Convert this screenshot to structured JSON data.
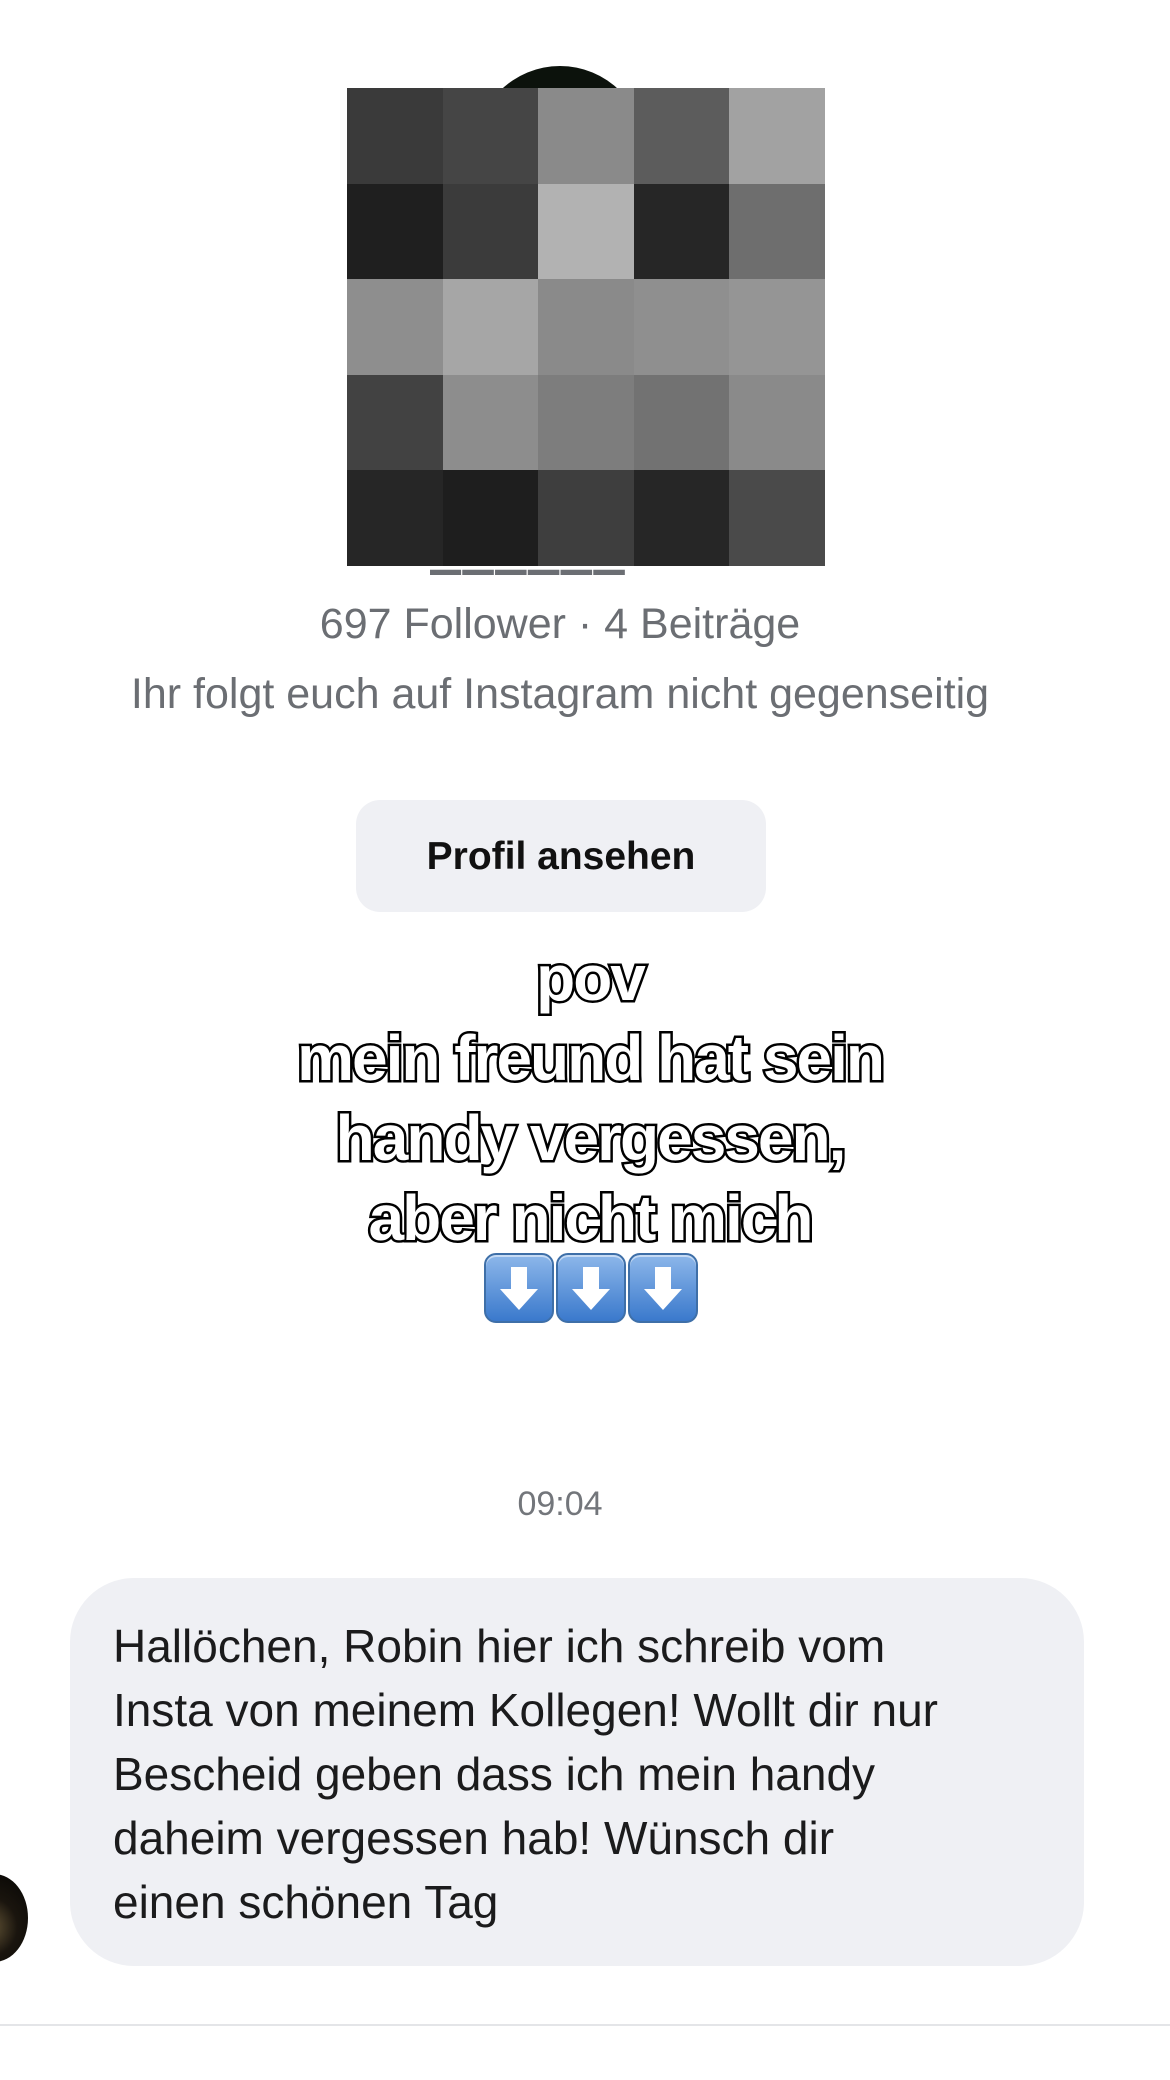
{
  "profile": {
    "stats": "697 Follower · 4 Beiträge",
    "mutual_status": "Ihr folgt euch auf Instagram nicht gegenseitig",
    "view_profile_label": "Profil ansehen",
    "avatar_pixel_colors": [
      "#3a3a3a",
      "#454545",
      "#8a8a8a",
      "#5c5c5c",
      "#a2a2a2",
      "#1f1f1f",
      "#3b3b3b",
      "#b2b2b2",
      "#262626",
      "#6e6e6e",
      "#8e8e8e",
      "#a6a6a6",
      "#8a8a8a",
      "#8f8f8f",
      "#959595",
      "#424242",
      "#8d8d8d",
      "#7d7d7d",
      "#727272",
      "#8a8a8a",
      "#262626",
      "#1e1e1e",
      "#3e3e3e",
      "#262626",
      "#4a4a4a"
    ]
  },
  "overlay": {
    "lines": [
      "pov",
      "mein freund hat sein",
      "handy vergessen,",
      "aber nicht mich"
    ],
    "arrow_emoji": [
      "⬇️",
      "⬇️",
      "⬇️"
    ]
  },
  "chat": {
    "timestamp": "09:04",
    "message_lines": [
      "Hallöchen, Robin hier ich schreib vom",
      "Insta von meinem Kollegen! Wollt dir nur",
      "Bescheid geben dass ich mein handy",
      "daheim vergessen hab! Wünsch dir",
      "einen schönen Tag"
    ]
  }
}
